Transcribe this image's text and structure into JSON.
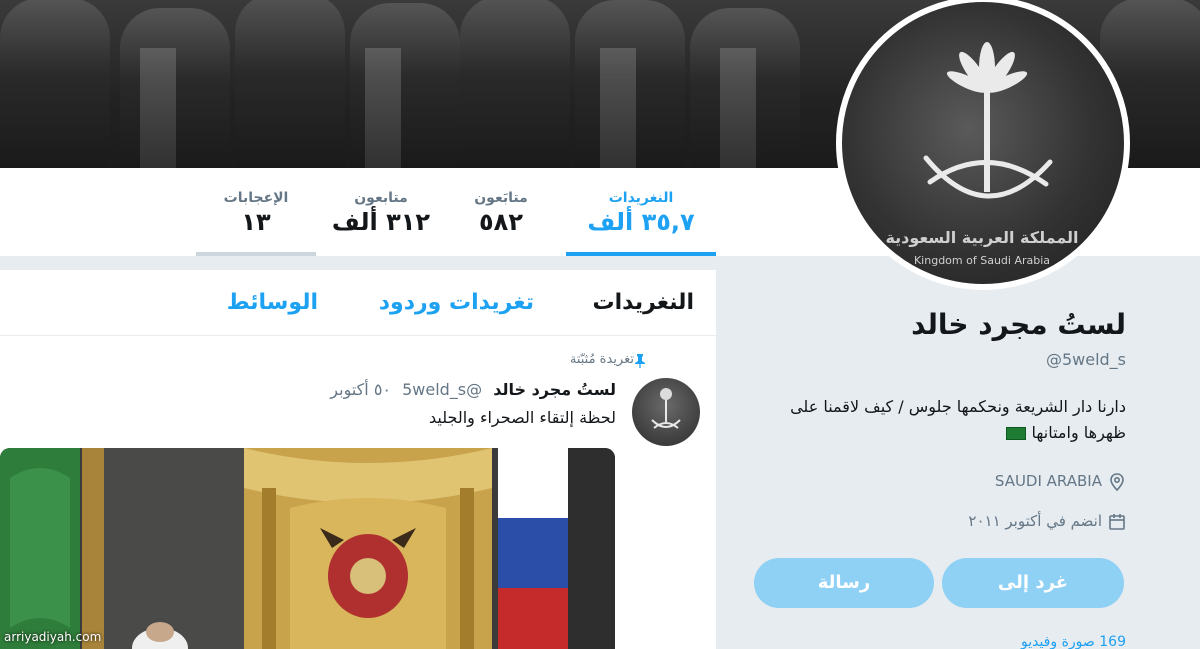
{
  "stats": [
    {
      "label": "النغريدات",
      "value": "٣٥,٧ ألف",
      "active": true
    },
    {
      "label": "متابَعون",
      "value": "٥٨٢",
      "active": false
    },
    {
      "label": "متابعون",
      "value": "٣١٢ ألف",
      "active": false
    },
    {
      "label": "الإعجابات",
      "value": "١٣",
      "active": false
    }
  ],
  "avatar": {
    "caption_ar": "المملكة العربية السعودية",
    "caption_en": "Kingdom of Saudi Arabia"
  },
  "profile": {
    "name": "لستُ مجرد خالد",
    "handle": "@5weld_s",
    "bio": "دارنا دار الشريعة ونحكمها جلوس / كيف لاقمنا على ظهرها وامتانها",
    "location": "SAUDI ARABIA",
    "joined": "انضم في أكتوبر ٢٠١١",
    "follow_button": "غرد إلى",
    "message_button": "رسالة",
    "extra_row": "169 صورة وفيديو"
  },
  "tabs": [
    {
      "label": "النغريدات",
      "active": true
    },
    {
      "label": "تغريدات وردود",
      "active": false
    },
    {
      "label": "الوسائط",
      "active": false
    }
  ],
  "tweet": {
    "pinned_label": "تغريدة مُثبّتة",
    "author_name": "لستُ مجرد خالد",
    "author_handle": "@5weld_s",
    "date": "٥٠ أكتوبر",
    "text": "لحظة إلتقاء الصحراء والجليد"
  },
  "watermark": "arriyadiyah.com",
  "colors": {
    "accent": "#1da1f2",
    "button": "#8fd0f5",
    "text": "#14171a",
    "muted": "#657786"
  }
}
